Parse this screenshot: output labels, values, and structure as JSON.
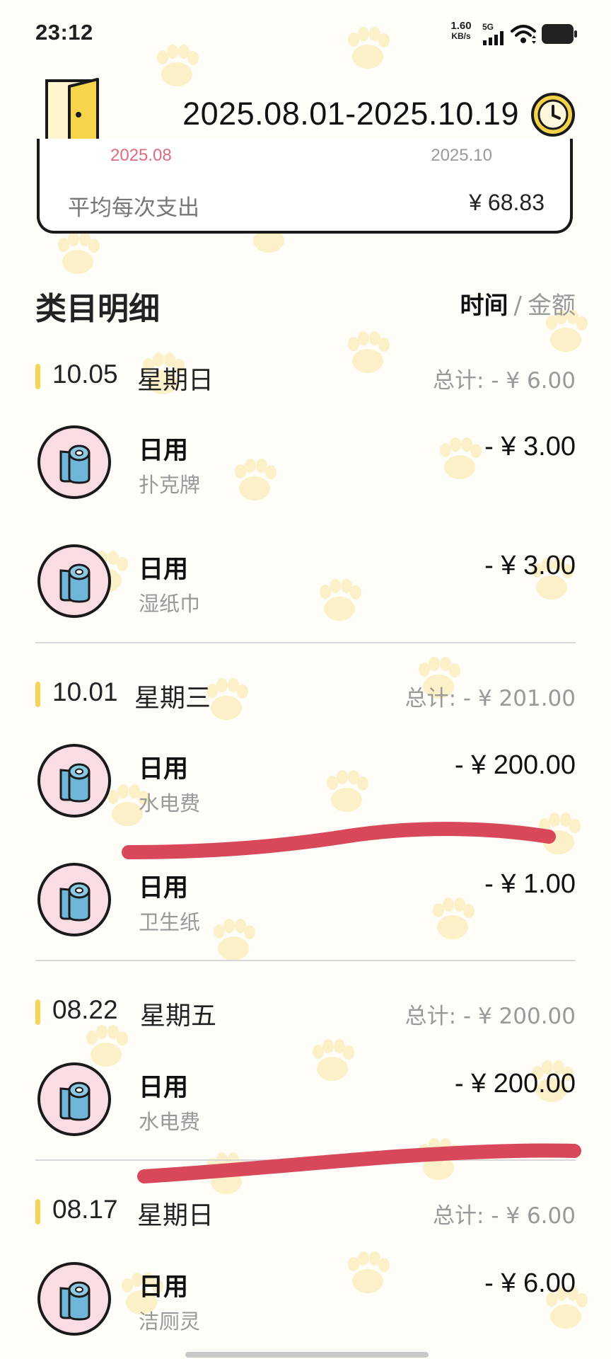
{
  "status_bar": {
    "time": "23:12",
    "net_speed_value": "1.60",
    "net_speed_unit": "KB/s",
    "network_type": "5G",
    "icons": [
      "signal-icon",
      "wifi-icon",
      "battery-icon"
    ]
  },
  "header": {
    "date_range": "2025.08.01-2025.10.19",
    "back_icon": "door-icon",
    "picker_icon": "clock-icon"
  },
  "summary": {
    "month_start": "2025.08",
    "month_end": "2025.10",
    "avg_label": "平均每次支出",
    "avg_value": "¥ 68.83"
  },
  "details": {
    "title": "类目明细",
    "sort_time": "时间",
    "sort_separator": "/",
    "sort_amount": "金额"
  },
  "days": [
    {
      "date": "10.05",
      "weekday": "星期日",
      "total": "总计: - ¥ 6.00",
      "transactions": [
        {
          "category": "日用",
          "note": "扑克牌",
          "amount": "- ¥ 3.00",
          "icon": "toilet-paper-icon"
        },
        {
          "category": "日用",
          "note": "湿纸巾",
          "amount": "- ¥ 3.00",
          "icon": "toilet-paper-icon"
        }
      ]
    },
    {
      "date": "10.01",
      "weekday": "星期三",
      "total": "总计: - ¥ 201.00",
      "transactions": [
        {
          "category": "日用",
          "note": "水电费",
          "amount": "- ¥ 200.00",
          "icon": "toilet-paper-icon"
        },
        {
          "category": "日用",
          "note": "卫生纸",
          "amount": "- ¥ 1.00",
          "icon": "toilet-paper-icon"
        }
      ]
    },
    {
      "date": "08.22",
      "weekday": "星期五",
      "total": "总计: - ¥ 200.00",
      "transactions": [
        {
          "category": "日用",
          "note": "水电费",
          "amount": "- ¥ 200.00",
          "icon": "toilet-paper-icon"
        }
      ]
    },
    {
      "date": "08.17",
      "weekday": "星期日",
      "total": "总计: - ¥ 6.00",
      "transactions": [
        {
          "category": "日用",
          "note": "洁厕灵",
          "amount": "- ¥ 6.00",
          "icon": "toilet-paper-icon"
        }
      ]
    }
  ],
  "colors": {
    "background": "#fffdf8",
    "paw_pattern": "#fcefc0",
    "accent_yellow": "#f4d45a",
    "month_pink": "#e06b81",
    "icon_circle": "#f9dde3",
    "roll_blue": "#6fb6d8",
    "annotation_red": "#d9485a"
  }
}
